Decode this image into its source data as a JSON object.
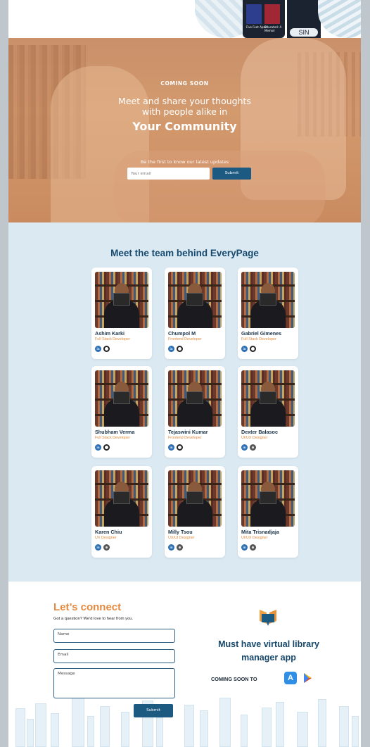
{
  "top_strip": {
    "phone_book_1": "Five Feet Apart",
    "phone_book_2": "Educated: A Memoir",
    "phone_card": "SIN"
  },
  "hero": {
    "eyebrow": "COMING SOON",
    "headline_line1": "Meet and share your thoughts",
    "headline_line2": "with people alike in",
    "headline_emphasis": "Your Community",
    "signup_prompt": "Be the first to know our latest updates",
    "email_placeholder": "Your email",
    "submit_label": "Submit"
  },
  "team": {
    "title": "Meet the team behind EveryPage",
    "members": [
      {
        "name": "Ashim Karki",
        "role": "Full Stack Developer",
        "links": [
          "linkedin",
          "github"
        ]
      },
      {
        "name": "Chumpol M",
        "role": "Frontend  Developer",
        "links": [
          "linkedin",
          "github"
        ]
      },
      {
        "name": "Gabriel Gimenes",
        "role": "Full Stack Developer",
        "links": [
          "linkedin",
          "github"
        ]
      },
      {
        "name": "Shubham Verma",
        "role": "Full Stack Developer",
        "links": [
          "linkedin",
          "github"
        ]
      },
      {
        "name": "Tejaswini Kumar",
        "role": "Frontend  Developer",
        "links": [
          "linkedin",
          "github"
        ]
      },
      {
        "name": "Dexter Balasoc",
        "role": "UI/UX Designer",
        "links": [
          "linkedin",
          "website"
        ]
      },
      {
        "name": "Karen Chiu",
        "role": "UX Designer",
        "links": [
          "linkedin",
          "website"
        ]
      },
      {
        "name": "Milly Tsou",
        "role": "UX/UI Designer",
        "links": [
          "linkedin",
          "website"
        ]
      },
      {
        "name": "Mita Trisnadjaja",
        "role": "UI/UX Designer",
        "links": [
          "linkedin",
          "website"
        ]
      }
    ]
  },
  "connect": {
    "title": "Let’s connect",
    "subtitle": "Got a question? We'd love to hear from you.",
    "name_placeholder": "Name",
    "email_placeholder": "Email",
    "message_placeholder": "Message",
    "submit_label": "Submit"
  },
  "app_promo": {
    "title_line1": "Must have virtual library",
    "title_line2": "manager app",
    "coming_soon_to": "COMING SOON TO",
    "stores": [
      "app-store-icon",
      "google-play-icon"
    ]
  },
  "colors": {
    "brand_blue": "#1d5a82",
    "title_blue": "#174a6e",
    "accent_orange": "#e58a3e",
    "team_bg": "#dbe9f3"
  }
}
